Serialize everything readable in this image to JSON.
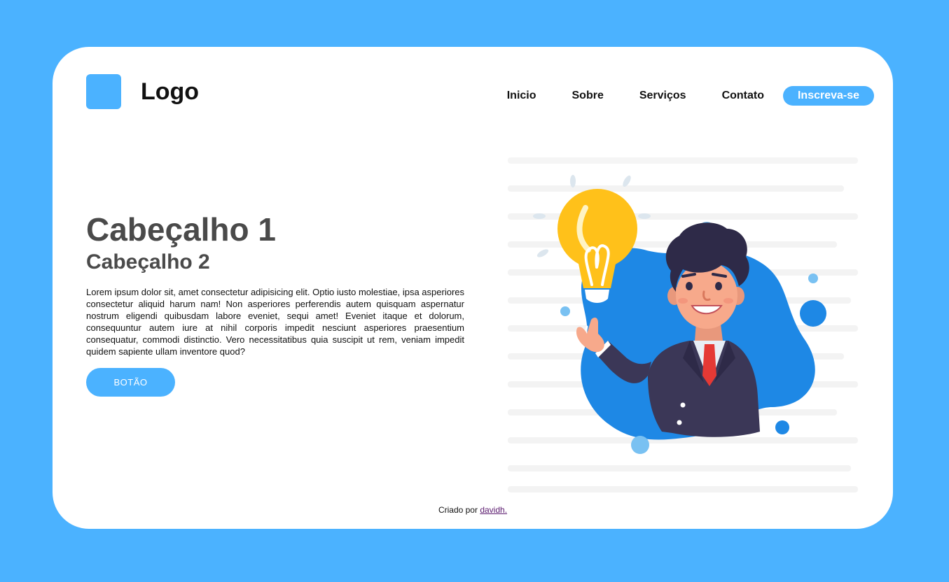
{
  "header": {
    "logo_text": "Logo",
    "nav": {
      "home": "Inicio",
      "about": "Sobre",
      "services": "Serviços",
      "contact": "Contato",
      "signup": "Inscreva-se"
    }
  },
  "hero": {
    "heading1": "Cabeçalho 1",
    "heading2": "Cabeçalho 2",
    "paragraph": "Lorem ipsum dolor sit, amet consectetur adipisicing elit. Optio iusto molestiae, ipsa asperiores consectetur aliquid harum nam! Non asperiores perferendis autem quisquam aspernatur nostrum eligendi quibusdam labore eveniet, sequi amet! Eveniet itaque et dolorum, consequuntur autem iure at nihil corporis impedit nesciunt asperiores praesentium consequatur, commodi distinctio. Vero necessitatibus quia suscipit ut rem, veniam impedit quidem sapiente ullam inventore quod?",
    "button": "BOTÃO"
  },
  "illustration": {
    "icon": "businessman-idea-lightbulb-illustration"
  },
  "footer": {
    "prefix": "Criado por",
    "author": "davidh."
  },
  "colors": {
    "background": "#4bb2ff",
    "card": "#ffffff",
    "accent": "#4bb2ff",
    "blob": "#1e88e5",
    "bulb": "#ffc11a",
    "suit": "#3b3757"
  }
}
